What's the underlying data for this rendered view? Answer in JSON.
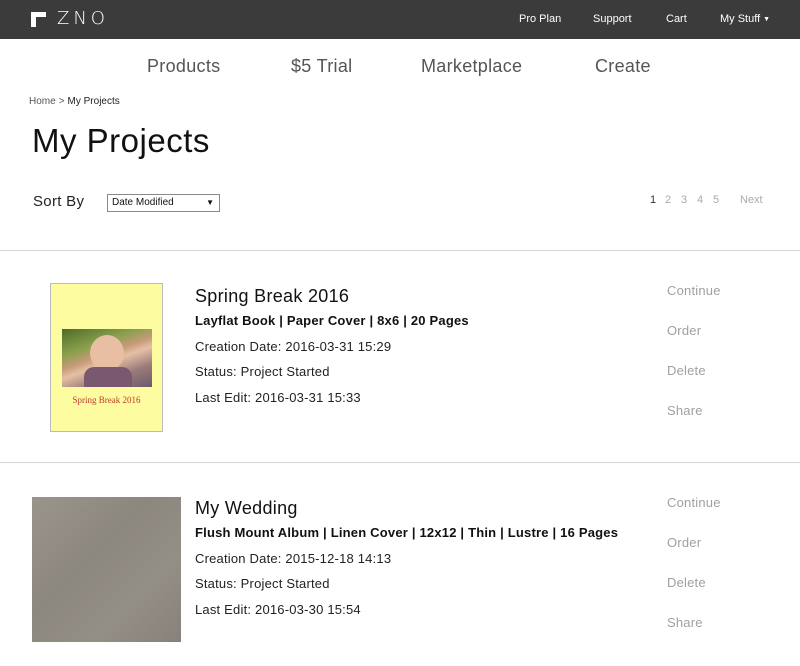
{
  "header": {
    "logo_text": "ZNO",
    "nav": [
      "Pro Plan",
      "Support",
      "Cart",
      "My Stuff"
    ]
  },
  "mainnav": [
    "Products",
    "$5 Trial",
    "Marketplace",
    "Create"
  ],
  "breadcrumb": {
    "home": "Home",
    "separator": ">",
    "current": "My Projects"
  },
  "page_title": "My Projects",
  "sort": {
    "label": "Sort By",
    "selected": "Date Modified"
  },
  "pagination": {
    "pages": [
      "1",
      "2",
      "3",
      "4",
      "5"
    ],
    "current": "1",
    "next": "Next"
  },
  "projects": [
    {
      "title": "Spring Break 2016",
      "thumb_caption": "Spring Break 2016",
      "spec": "Layflat Book | Paper Cover | 8x6 | 20 Pages",
      "creation": "Creation Date: 2016-03-31 15:29",
      "status": "Status: Project Started",
      "last_edit": "Last Edit: 2016-03-31 15:33",
      "actions": [
        "Continue",
        "Order",
        "Delete",
        "Share"
      ]
    },
    {
      "title": "My Wedding",
      "spec": "Flush Mount Album | Linen Cover | 12x12 | Thin | Lustre | 16 Pages",
      "creation": "Creation Date: 2015-12-18 14:13",
      "status": "Status: Project Started",
      "last_edit": "Last Edit: 2016-03-30 15:54",
      "actions": [
        "Continue",
        "Order",
        "Delete",
        "Share"
      ]
    }
  ],
  "colors": {
    "topbar": "#3b3b3b",
    "action_text": "#a0a0a0",
    "thumb_bg": "#fdfca0"
  }
}
